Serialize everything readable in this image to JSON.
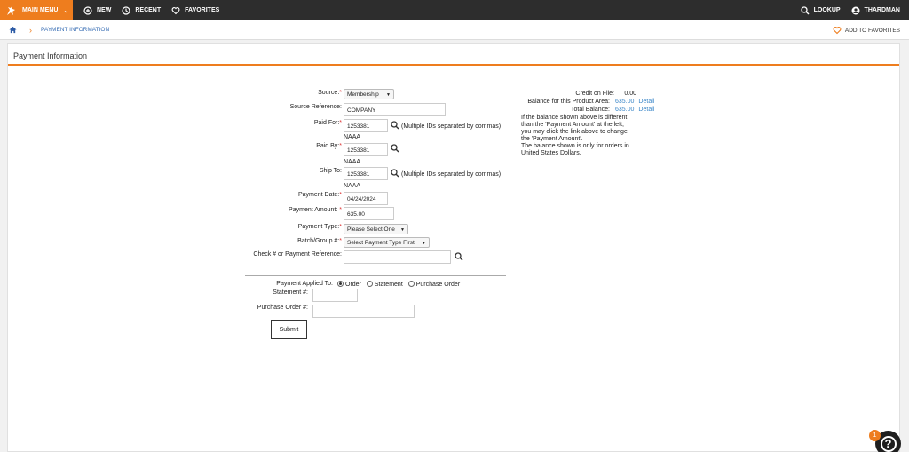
{
  "nav": {
    "main_menu": "MAIN MENU",
    "new": "NEW",
    "recent": "RECENT",
    "favorites": "FAVORITES",
    "lookup": "LOOKUP",
    "user": "THARDMAN"
  },
  "breadcrumb": {
    "current": "PAYMENT INFORMATION",
    "add_favorites": "ADD TO FAVORITES"
  },
  "panel": {
    "title": "Payment Information"
  },
  "form": {
    "source": {
      "label": "Source:",
      "required": "*",
      "value": "Membership"
    },
    "source_reference": {
      "label": "Source Reference:",
      "value": "COMPANY"
    },
    "paid_for": {
      "label": "Paid For:",
      "required": "*",
      "value": "1253381",
      "hint": "(Multiple IDs separated by commas)",
      "name": "NAAA"
    },
    "paid_by": {
      "label": "Paid By:",
      "required": "*",
      "value": "1253381",
      "name": "NAAA"
    },
    "ship_to": {
      "label": "Ship To:",
      "value": "1253381",
      "hint": "(Multiple IDs separated by commas)",
      "name": "NAAA"
    },
    "payment_date": {
      "label": "Payment Date:",
      "required": "*",
      "value": "04/24/2024"
    },
    "payment_amount": {
      "label": "Payment Amount:",
      "required": "*",
      "value": "635.00"
    },
    "payment_type": {
      "label": "Payment Type:",
      "required": "*",
      "value": "Please Select One"
    },
    "batch_group": {
      "label": "Batch/Group #:",
      "required": "*",
      "value": "Select Payment Type First"
    },
    "check_reference": {
      "label": "Check # or Payment Reference:",
      "value": ""
    },
    "applied_to": {
      "label": "Payment Applied To:",
      "options": [
        "Order",
        "Statement",
        "Purchase Order"
      ],
      "selected": "Order"
    },
    "statement": {
      "label": "Statement #:",
      "value": ""
    },
    "purchase_order": {
      "label": "Purchase Order #:",
      "value": ""
    },
    "submit": "Submit"
  },
  "balance": {
    "credit_label": "Credit on File:",
    "credit_value": "0.00",
    "product_label": "Balance for this Product Area:",
    "product_value": "635.00",
    "product_detail": "Detail",
    "total_label": "Total Balance:",
    "total_value": "635.00",
    "total_detail": "Detail",
    "note_lines": [
      "If the balance shown above is different",
      "than the 'Payment Amount' at the left,",
      "you may click the link above to change",
      "the 'Payment Amount'.",
      "The balance shown is only for orders in",
      "United States Dollars."
    ]
  },
  "help": {
    "badge": "1",
    "glyph": "?"
  }
}
